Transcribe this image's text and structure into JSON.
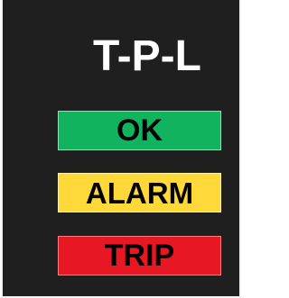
{
  "panel": {
    "title": "T-P-L",
    "statuses": [
      {
        "label": "OK",
        "color": "#12b35f"
      },
      {
        "label": "ALARM",
        "color": "#ffd83a"
      },
      {
        "label": "TRIP",
        "color": "#e81724"
      }
    ]
  }
}
